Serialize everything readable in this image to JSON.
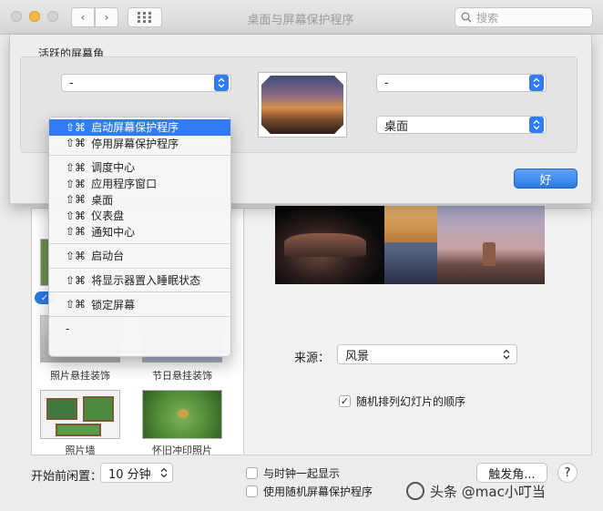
{
  "titlebar": {
    "title": "桌面与屏幕保护程序",
    "search_placeholder": "搜索"
  },
  "sheet": {
    "title": "活跃的屏幕角",
    "top_left": "-",
    "top_right": "-",
    "bottom_right": "桌面",
    "ok_label": "好"
  },
  "menu": {
    "items": [
      {
        "mod": "⇧⌘",
        "label": "启动屏幕保护程序",
        "selected": true
      },
      {
        "mod": "⇧⌘",
        "label": "停用屏幕保护程序"
      },
      {
        "sep": true
      },
      {
        "mod": "⇧⌘",
        "label": "调度中心"
      },
      {
        "mod": "⇧⌘",
        "label": "应用程序窗口"
      },
      {
        "mod": "⇧⌘",
        "label": "桌面"
      },
      {
        "mod": "⇧⌘",
        "label": "仪表盘"
      },
      {
        "mod": "⇧⌘",
        "label": "通知中心"
      },
      {
        "sep": true
      },
      {
        "mod": "⇧⌘",
        "label": "启动台"
      },
      {
        "sep": true
      },
      {
        "mod": "⇧⌘",
        "label": "将显示器置入睡眠状态"
      },
      {
        "sep": true
      },
      {
        "mod": "⇧⌘",
        "label": "锁定屏幕"
      },
      {
        "sep": true
      },
      {
        "mod": "",
        "label": "-"
      }
    ]
  },
  "screensavers": {
    "items": [
      {
        "label": "照片悬挂装饰"
      },
      {
        "label": "节日悬挂装饰"
      },
      {
        "label": "照片墙"
      },
      {
        "label": "怀旧冲印照片"
      }
    ]
  },
  "options": {
    "source_label": "来源：",
    "source_value": "风景",
    "shuffle_label": "随机排列幻灯片的顺序",
    "shuffle_checked": true,
    "clock_label": "与时钟一起显示",
    "random_label": "使用随机屏幕保护程序"
  },
  "bottom": {
    "idle_label": "开始前闲置：",
    "idle_value": "10 分钟",
    "hot_corners_label": "触发角...",
    "help_label": "?"
  },
  "watermark": {
    "text": "头条 @mac小叮当"
  }
}
